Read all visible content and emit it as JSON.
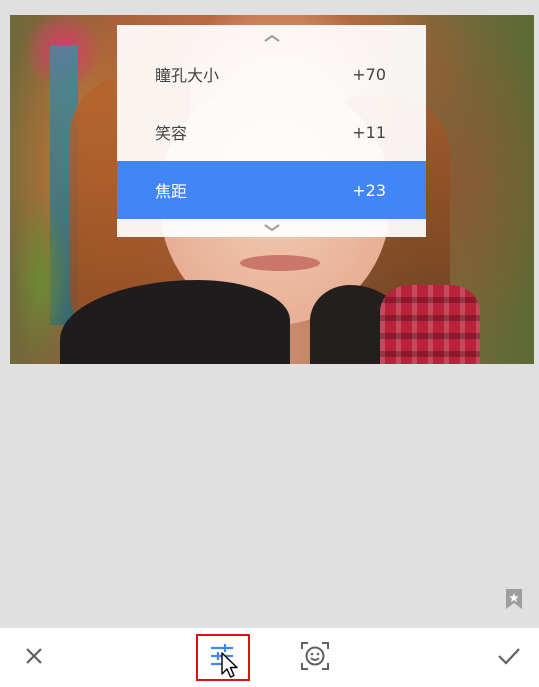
{
  "menu": {
    "items": [
      {
        "label": "瞳孔大小",
        "value": "+70",
        "selected": false
      },
      {
        "label": "笑容",
        "value": "+11",
        "selected": false
      },
      {
        "label": "焦距",
        "value": "+23",
        "selected": true
      }
    ],
    "scroll_up_icon": "chevron-up-icon",
    "scroll_down_icon": "chevron-down-icon"
  },
  "toolbar": {
    "close_icon": "close-icon",
    "tune_icon": "tune-sliders-icon",
    "face_icon": "face-detect-icon",
    "apply_icon": "check-icon"
  },
  "bookmark_icon": "bookmark-star-icon",
  "colors": {
    "accent": "#4285f4",
    "highlight": "#e01010",
    "icon": "#616161"
  }
}
